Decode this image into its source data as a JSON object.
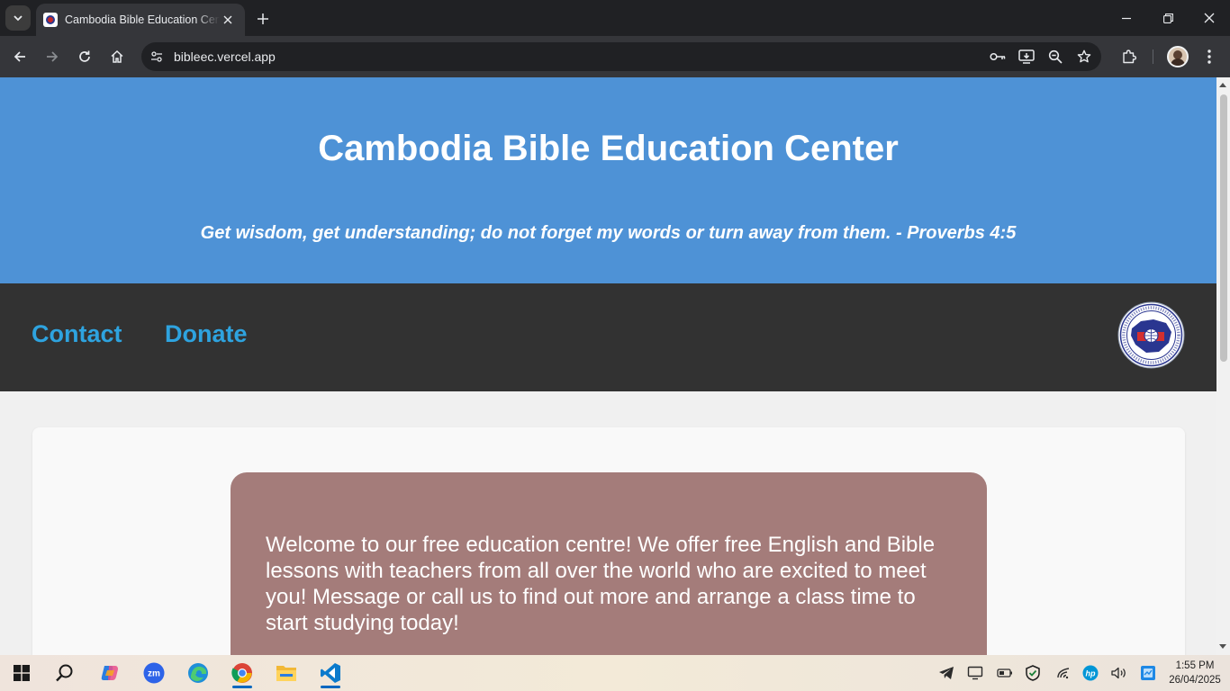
{
  "browser": {
    "tab_title": "Cambodia Bible Education Center",
    "url": "bibleec.vercel.app"
  },
  "site": {
    "title": "Cambodia Bible Education Center",
    "verse": "Get wisdom, get understanding; do not forget my words or turn away from them. - Proverbs 4:5",
    "nav": {
      "contact": "Contact",
      "donate": "Donate"
    },
    "welcome": "Welcome to our free education centre! We offer free English and Bible lessons with teachers from all over the world who are excited to meet you! Message or call us to find out more and arrange a class time to start studying today!"
  },
  "taskbar": {
    "time": "1:55 PM",
    "date": "26/04/2025",
    "apps": [
      "start-icon",
      "search-icon",
      "copilot-icon",
      "zoom-icon",
      "edge-icon",
      "chrome-icon",
      "file-explorer-icon",
      "vscode-icon"
    ]
  },
  "colors": {
    "header_bg": "#4e92d6",
    "nav_bg": "#323232",
    "nav_link": "#2ea3df",
    "welcome_box": "#a47c7a"
  }
}
